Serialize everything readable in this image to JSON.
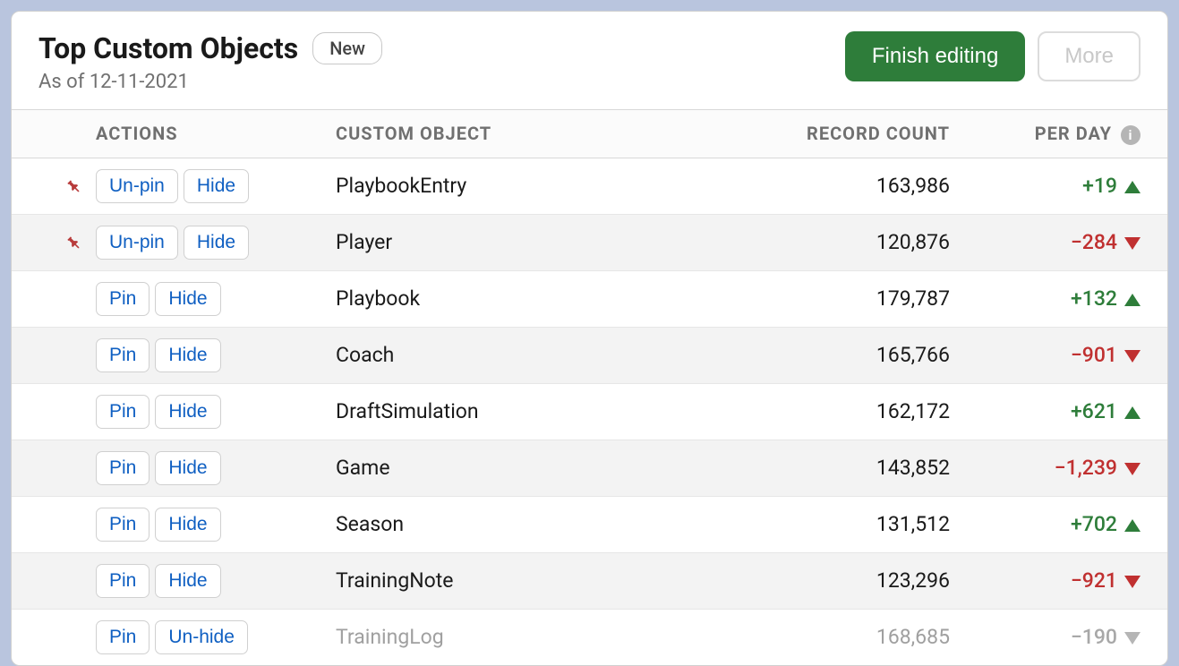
{
  "header": {
    "title": "Top Custom Objects",
    "badge": "New",
    "subtitle": "As of 12-11-2021",
    "finish_label": "Finish editing",
    "more_label": "More"
  },
  "columns": {
    "actions": "ACTIONS",
    "object": "CUSTOM OBJECT",
    "count": "RECORD COUNT",
    "perday": "PER DAY"
  },
  "labels": {
    "pin": "Pin",
    "unpin": "Un-pin",
    "hide": "Hide",
    "unhide": "Un-hide"
  },
  "rows": [
    {
      "pinned": true,
      "hidden": false,
      "object": "PlaybookEntry",
      "count": "163,986",
      "delta": "+19",
      "dir": "up"
    },
    {
      "pinned": true,
      "hidden": false,
      "object": "Player",
      "count": "120,876",
      "delta": "−284",
      "dir": "down"
    },
    {
      "pinned": false,
      "hidden": false,
      "object": "Playbook",
      "count": "179,787",
      "delta": "+132",
      "dir": "up"
    },
    {
      "pinned": false,
      "hidden": false,
      "object": "Coach",
      "count": "165,766",
      "delta": "−901",
      "dir": "down"
    },
    {
      "pinned": false,
      "hidden": false,
      "object": "DraftSimulation",
      "count": "162,172",
      "delta": "+621",
      "dir": "up"
    },
    {
      "pinned": false,
      "hidden": false,
      "object": "Game",
      "count": "143,852",
      "delta": "−1,239",
      "dir": "down"
    },
    {
      "pinned": false,
      "hidden": false,
      "object": "Season",
      "count": "131,512",
      "delta": "+702",
      "dir": "up"
    },
    {
      "pinned": false,
      "hidden": false,
      "object": "TrainingNote",
      "count": "123,296",
      "delta": "−921",
      "dir": "down"
    },
    {
      "pinned": false,
      "hidden": true,
      "object": "TrainingLog",
      "count": "168,685",
      "delta": "−190",
      "dir": "muted"
    }
  ]
}
